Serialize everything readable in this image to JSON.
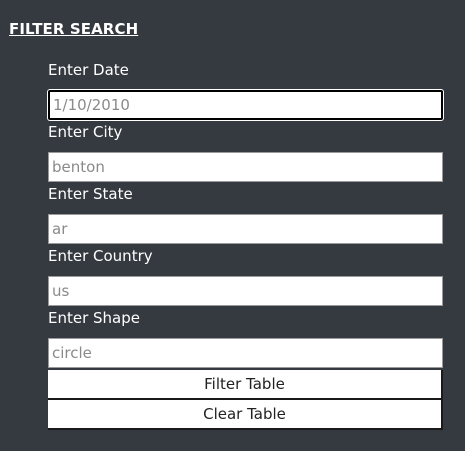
{
  "title": "FILTER SEARCH",
  "fields": [
    {
      "label": "Enter Date",
      "placeholder": "1/10/2010"
    },
    {
      "label": "Enter City",
      "placeholder": "benton"
    },
    {
      "label": "Enter State",
      "placeholder": "ar"
    },
    {
      "label": "Enter Country",
      "placeholder": "us"
    },
    {
      "label": "Enter Shape",
      "placeholder": "circle"
    }
  ],
  "buttons": {
    "filter": "Filter Table",
    "clear": "Clear Table"
  }
}
